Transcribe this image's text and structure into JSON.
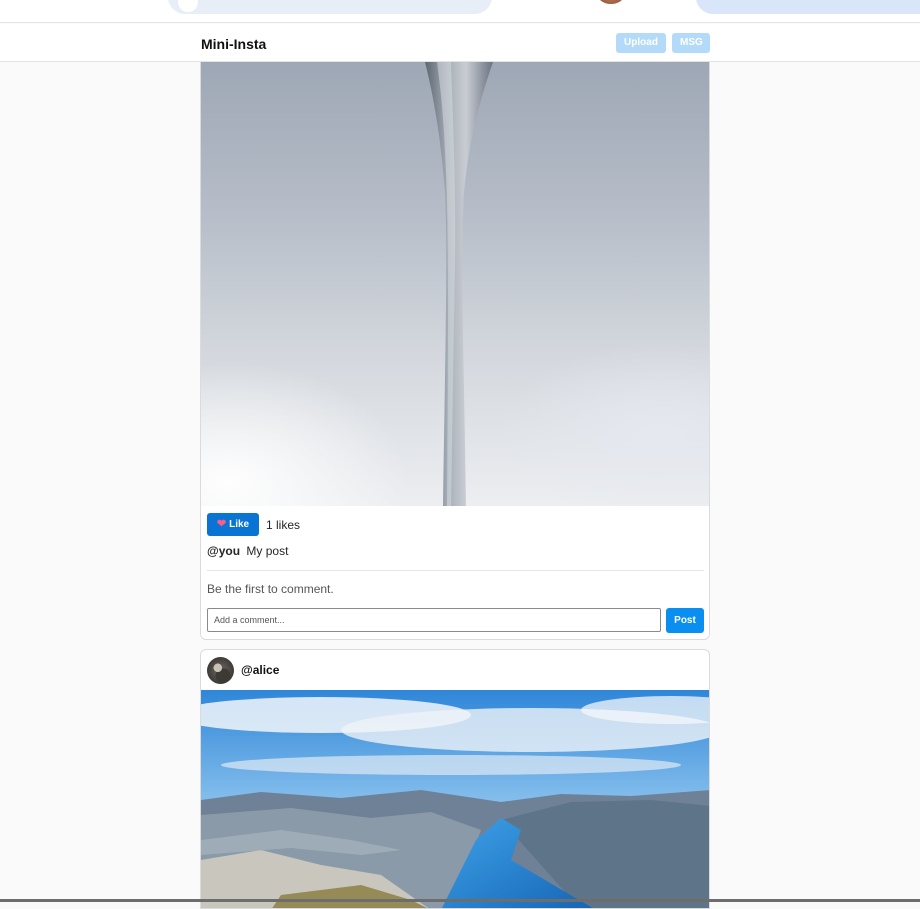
{
  "header": {
    "title": "Mini-Insta",
    "upload_label": "Upload",
    "msg_label": "MSG"
  },
  "feed": {
    "posts": [
      {
        "like_label": "Like",
        "likes_text": "1 likes",
        "caption_user": "@you",
        "caption_text": "My post",
        "no_comments_text": "Be the first to comment.",
        "comment_placeholder": "Add a comment...",
        "post_button_label": "Post",
        "liked": true
      },
      {
        "username": "@alice"
      }
    ]
  },
  "colors": {
    "accent": "#0a74d4",
    "post_button": "#0a8ff0",
    "header_button_disabled": "#b3dbf9",
    "background": "#fafafa"
  },
  "icons": {
    "like": "heart-icon"
  }
}
